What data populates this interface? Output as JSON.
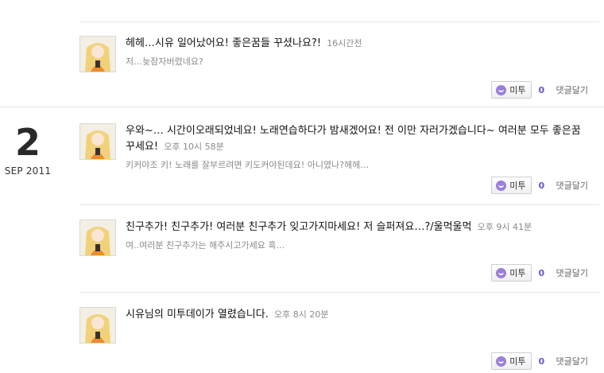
{
  "date_block": {
    "day": "2",
    "month_year": "SEP 2011"
  },
  "posts": [
    {
      "message": "헤헤…시유 일어났어요! 좋은꿈들 꾸셨나요?!",
      "time": "16시간전",
      "comment_preview": "저…늦잠자버렸네요?",
      "metoo_label": "미투",
      "metoo_count": "0",
      "reply_label": "댓글달기"
    },
    {
      "message": "우와~… 시간이오래되었네요! 노래연습하다가 밤새겠어요! 전 이만 자러가겠습니다~ 여러분 모두 좋은꿈 꾸세요!",
      "time": "오후 10시 58분",
      "comment_preview": "키커야조 키! 노래를 잘부르려면 키도커야된데요! 아니였나?헤헤…",
      "metoo_label": "미투",
      "metoo_count": "0",
      "reply_label": "댓글달기"
    },
    {
      "message": "친구추가! 친구추가! 여러분 친구추가 잊고가지마세요! 저 슬퍼져요…?/울먹울먹",
      "time": "오후 9시 41분",
      "comment_preview": "여..여러분 친구추가는 해주시고가세요 흑…",
      "metoo_label": "미투",
      "metoo_count": "0",
      "reply_label": "댓글달기"
    },
    {
      "message": "시유님의 미투데이가 열렸습니다.",
      "time": "오후 8시 20분",
      "comment_preview": "",
      "metoo_label": "미투",
      "metoo_count": "0",
      "reply_label": "댓글달기"
    }
  ],
  "colors": {
    "accent": "#6b58c9",
    "metoo_icon": "#9b7fd9",
    "divider": "#e6e6e6"
  }
}
